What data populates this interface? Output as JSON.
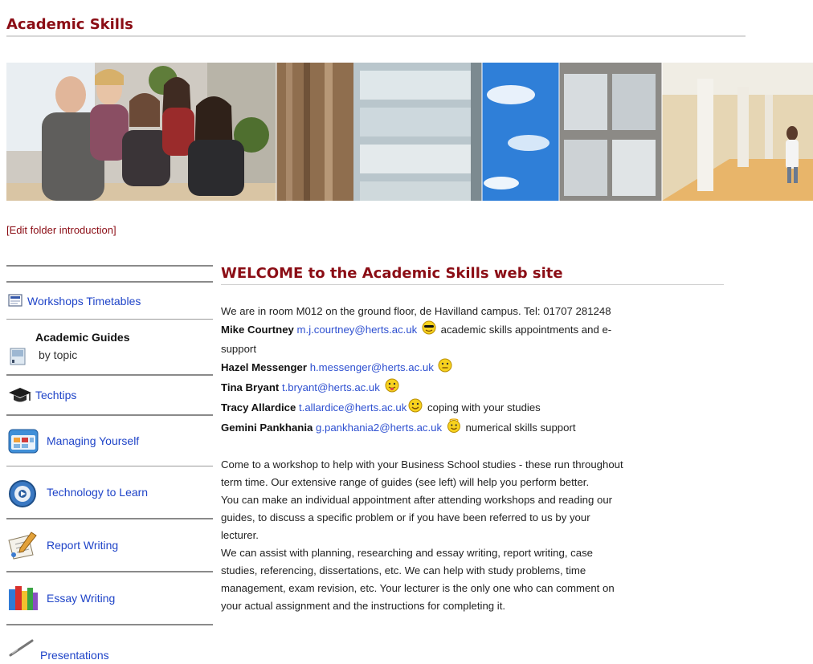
{
  "header": {
    "title": "Academic Skills"
  },
  "edit_link": "[Edit folder introduction]",
  "sidebar": {
    "items": [
      {
        "label": "Workshops Timetables",
        "icon": "document-icon"
      },
      {
        "heading": "Academic Guides",
        "sub": "by topic",
        "icon": "book-icon"
      },
      {
        "label": "Techtips",
        "icon": "graduation-cap-icon"
      },
      {
        "label": "Managing Yourself",
        "icon": "calendar-icon"
      },
      {
        "label": "Technology to Learn",
        "icon": "media-icon"
      },
      {
        "label": "Report Writing",
        "icon": "pen-paper-icon"
      },
      {
        "label": "Essay Writing",
        "icon": "books-icon"
      },
      {
        "label": "Presentations",
        "icon": "pointer-icon"
      }
    ]
  },
  "main": {
    "title": "WELCOME to the Academic Skills web site",
    "location": "We are in room M012 on the ground floor, de Havilland campus.  Tel: 01707 281248",
    "contacts": [
      {
        "name": "Mike Courtney",
        "email": "m.j.courtney@herts.ac.uk",
        "note_1": "academic skills appointments and e-",
        "note_2": "support",
        "smiley": "cool-smiley-icon"
      },
      {
        "name": "Hazel Messenger",
        "email": "h.messenger@herts.ac.uk",
        "note_1": "",
        "smiley": "neutral-smiley-icon"
      },
      {
        "name": "Tina Bryant",
        "email": "t.bryant@herts.ac.uk",
        "note_1": "",
        "smiley": "tongue-smiley-icon"
      },
      {
        "name": "Tracy Allardice",
        "email": "t.allardice@herts.ac.uk",
        "note_1": "coping with your studies",
        "smiley": "smile-smiley-icon"
      },
      {
        "name": "Gemini Pankhania",
        "email": "g.pankhania2@herts.ac.uk",
        "note_1": "numerical skills support",
        "smiley": "angel-smiley-icon"
      }
    ],
    "paragraphs": [
      "Come to a workshop to help with your Business School studies - these run throughout",
      "term time. Our extensive range of guides (see left) will help you perform better.",
      "You can make an individual appointment after attending workshops and reading our",
      "guides, to discuss a specific problem or if you have been referred to us by your",
      "lecturer.",
      "We can assist with  planning, researching and essay writing, report writing, case",
      "studies, referencing, dissertations, etc. We can help with study problems, time",
      "management, exam revision, etc. Your lecturer is the only one who can comment on",
      "your actual assignment and the instructions for completing it."
    ]
  },
  "colors": {
    "accent": "#8b0d15",
    "link": "#1f44c8"
  }
}
